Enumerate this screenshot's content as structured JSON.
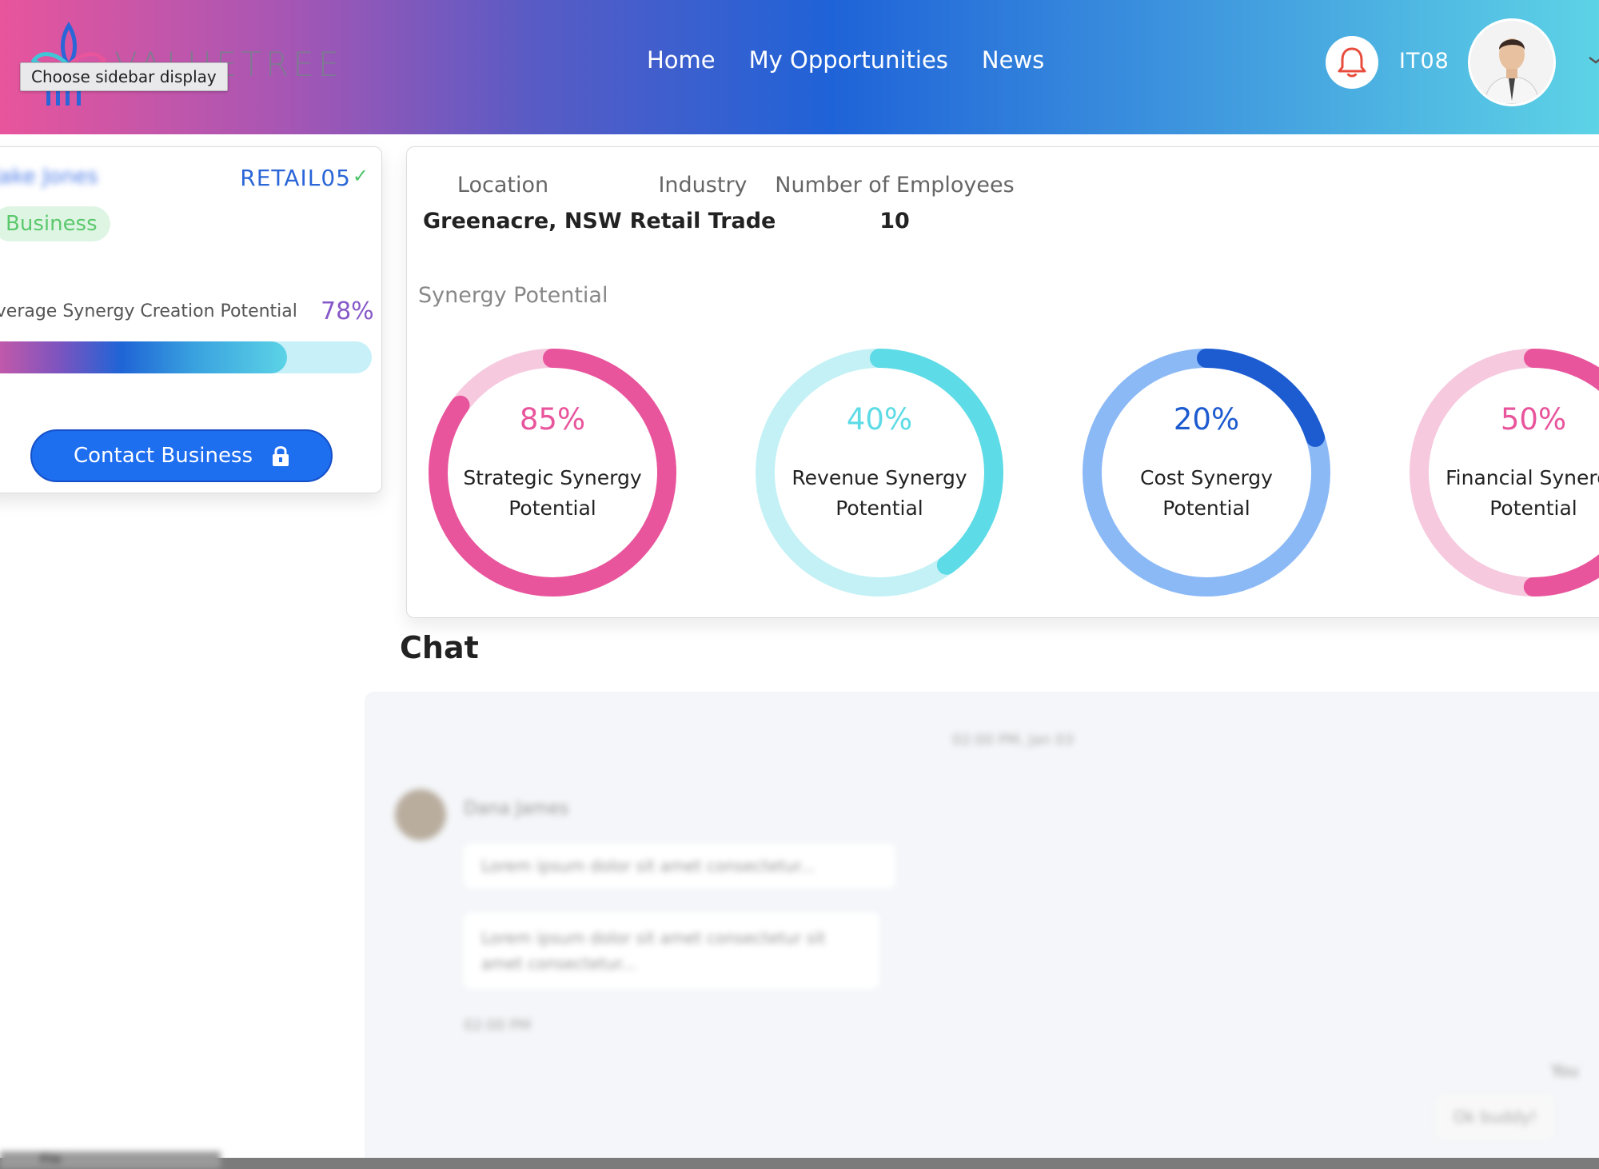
{
  "header": {
    "tooltip": "Choose sidebar display",
    "logo_text": "VALUETREE",
    "nav": [
      "Home",
      "My Opportunities",
      "News"
    ],
    "username": "IT08"
  },
  "left_card": {
    "name": "Jake Jones",
    "code": "RETAIL05",
    "badge": "Business",
    "potential_label": "Average Synergy Creation Potential",
    "potential_value": "78%",
    "potential_fraction": 0.78,
    "contact_button": "Contact Business"
  },
  "main_card": {
    "info": [
      {
        "label": "Location",
        "value": "Greenacre, NSW"
      },
      {
        "label": "Industry",
        "value": "Retail Trade"
      },
      {
        "label": "Number of Employees",
        "value": "10"
      }
    ],
    "synergy_title": "Synergy Potential",
    "gauges": [
      {
        "percent": "85%",
        "fraction": 0.85,
        "line1": "Strategic Synergy",
        "line2": "Potential",
        "color": "#e8559c",
        "track": "#f6c9de"
      },
      {
        "percent": "40%",
        "fraction": 0.4,
        "line1": "Revenue Synergy",
        "line2": "Potential",
        "color": "#5ddbe6",
        "track": "#c3f1f5"
      },
      {
        "percent": "20%",
        "fraction": 0.2,
        "line1": "Cost Synergy",
        "line2": "Potential",
        "color": "#1d5bd0",
        "track": "#8bb9f6"
      },
      {
        "percent": "50%",
        "fraction": 0.5,
        "line1": "Financial Synergy",
        "line2": "Potential",
        "color": "#e8559c",
        "track": "#f6c9de"
      }
    ]
  },
  "chat": {
    "title": "Chat",
    "date": "02:00 PM, Jan 03",
    "sender": "Dana James",
    "messages": [
      "Lorem ipsum dolor sit amet consectetur...",
      "Lorem ipsum dolor sit amet consectetur sit amet consectetur..."
    ],
    "time": "02:00 PM",
    "you_label": "You",
    "you_message": "Ok buddy!"
  },
  "footer": {
    "tab": "File"
  }
}
